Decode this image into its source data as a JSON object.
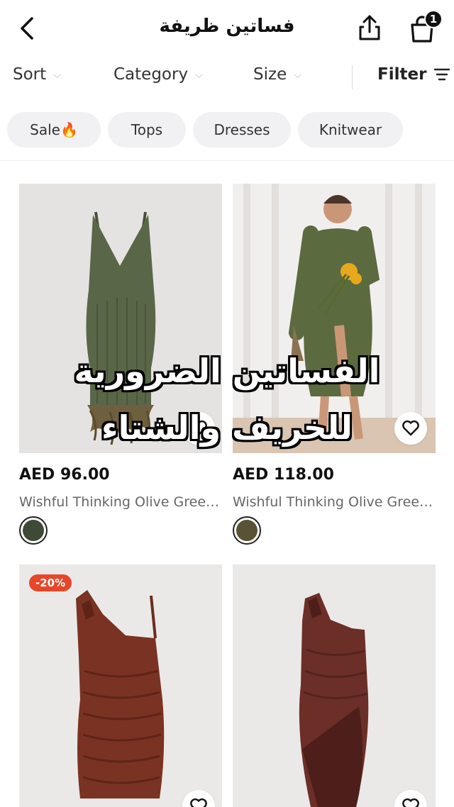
{
  "header": {
    "title": "فساتين ظريفة",
    "cart_count": "1",
    "icons": {
      "back": "chevron-left-icon",
      "share": "share-icon",
      "bag": "shopping-bag-icon"
    }
  },
  "filters": {
    "sort": "Sort",
    "category": "Category",
    "size": "Size",
    "filter": "Filter"
  },
  "chips": [
    {
      "label": "Sale🔥"
    },
    {
      "label": "Tops"
    },
    {
      "label": "Dresses"
    },
    {
      "label": "Knitwear"
    }
  ],
  "products": [
    {
      "price": "AED 96.00",
      "name": "Wishful Thinking Olive Green Fe…",
      "swatch_color": "#3f4a36"
    },
    {
      "price": "AED 118.00",
      "name": "Wishful Thinking Olive Green Ri…",
      "swatch_color": "#5a5236"
    },
    {
      "discount": "-20%"
    },
    {}
  ],
  "overlay": {
    "line1": "الفساتين الضرورية",
    "line2": "للخريف والشتاء"
  }
}
